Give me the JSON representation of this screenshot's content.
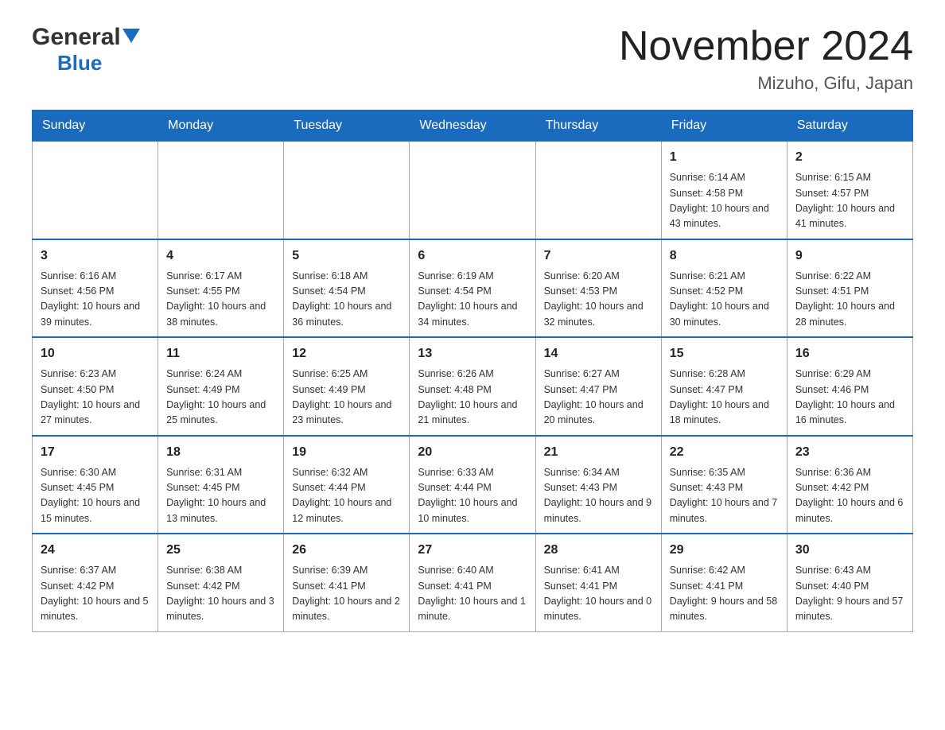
{
  "logo": {
    "general": "General",
    "blue": "Blue",
    "triangle_color": "#1a6bbd"
  },
  "header": {
    "month_year": "November 2024",
    "location": "Mizuho, Gifu, Japan"
  },
  "weekdays": [
    "Sunday",
    "Monday",
    "Tuesday",
    "Wednesday",
    "Thursday",
    "Friday",
    "Saturday"
  ],
  "weeks": [
    [
      {
        "day": "",
        "info": ""
      },
      {
        "day": "",
        "info": ""
      },
      {
        "day": "",
        "info": ""
      },
      {
        "day": "",
        "info": ""
      },
      {
        "day": "",
        "info": ""
      },
      {
        "day": "1",
        "info": "Sunrise: 6:14 AM\nSunset: 4:58 PM\nDaylight: 10 hours and 43 minutes."
      },
      {
        "day": "2",
        "info": "Sunrise: 6:15 AM\nSunset: 4:57 PM\nDaylight: 10 hours and 41 minutes."
      }
    ],
    [
      {
        "day": "3",
        "info": "Sunrise: 6:16 AM\nSunset: 4:56 PM\nDaylight: 10 hours and 39 minutes."
      },
      {
        "day": "4",
        "info": "Sunrise: 6:17 AM\nSunset: 4:55 PM\nDaylight: 10 hours and 38 minutes."
      },
      {
        "day": "5",
        "info": "Sunrise: 6:18 AM\nSunset: 4:54 PM\nDaylight: 10 hours and 36 minutes."
      },
      {
        "day": "6",
        "info": "Sunrise: 6:19 AM\nSunset: 4:54 PM\nDaylight: 10 hours and 34 minutes."
      },
      {
        "day": "7",
        "info": "Sunrise: 6:20 AM\nSunset: 4:53 PM\nDaylight: 10 hours and 32 minutes."
      },
      {
        "day": "8",
        "info": "Sunrise: 6:21 AM\nSunset: 4:52 PM\nDaylight: 10 hours and 30 minutes."
      },
      {
        "day": "9",
        "info": "Sunrise: 6:22 AM\nSunset: 4:51 PM\nDaylight: 10 hours and 28 minutes."
      }
    ],
    [
      {
        "day": "10",
        "info": "Sunrise: 6:23 AM\nSunset: 4:50 PM\nDaylight: 10 hours and 27 minutes."
      },
      {
        "day": "11",
        "info": "Sunrise: 6:24 AM\nSunset: 4:49 PM\nDaylight: 10 hours and 25 minutes."
      },
      {
        "day": "12",
        "info": "Sunrise: 6:25 AM\nSunset: 4:49 PM\nDaylight: 10 hours and 23 minutes."
      },
      {
        "day": "13",
        "info": "Sunrise: 6:26 AM\nSunset: 4:48 PM\nDaylight: 10 hours and 21 minutes."
      },
      {
        "day": "14",
        "info": "Sunrise: 6:27 AM\nSunset: 4:47 PM\nDaylight: 10 hours and 20 minutes."
      },
      {
        "day": "15",
        "info": "Sunrise: 6:28 AM\nSunset: 4:47 PM\nDaylight: 10 hours and 18 minutes."
      },
      {
        "day": "16",
        "info": "Sunrise: 6:29 AM\nSunset: 4:46 PM\nDaylight: 10 hours and 16 minutes."
      }
    ],
    [
      {
        "day": "17",
        "info": "Sunrise: 6:30 AM\nSunset: 4:45 PM\nDaylight: 10 hours and 15 minutes."
      },
      {
        "day": "18",
        "info": "Sunrise: 6:31 AM\nSunset: 4:45 PM\nDaylight: 10 hours and 13 minutes."
      },
      {
        "day": "19",
        "info": "Sunrise: 6:32 AM\nSunset: 4:44 PM\nDaylight: 10 hours and 12 minutes."
      },
      {
        "day": "20",
        "info": "Sunrise: 6:33 AM\nSunset: 4:44 PM\nDaylight: 10 hours and 10 minutes."
      },
      {
        "day": "21",
        "info": "Sunrise: 6:34 AM\nSunset: 4:43 PM\nDaylight: 10 hours and 9 minutes."
      },
      {
        "day": "22",
        "info": "Sunrise: 6:35 AM\nSunset: 4:43 PM\nDaylight: 10 hours and 7 minutes."
      },
      {
        "day": "23",
        "info": "Sunrise: 6:36 AM\nSunset: 4:42 PM\nDaylight: 10 hours and 6 minutes."
      }
    ],
    [
      {
        "day": "24",
        "info": "Sunrise: 6:37 AM\nSunset: 4:42 PM\nDaylight: 10 hours and 5 minutes."
      },
      {
        "day": "25",
        "info": "Sunrise: 6:38 AM\nSunset: 4:42 PM\nDaylight: 10 hours and 3 minutes."
      },
      {
        "day": "26",
        "info": "Sunrise: 6:39 AM\nSunset: 4:41 PM\nDaylight: 10 hours and 2 minutes."
      },
      {
        "day": "27",
        "info": "Sunrise: 6:40 AM\nSunset: 4:41 PM\nDaylight: 10 hours and 1 minute."
      },
      {
        "day": "28",
        "info": "Sunrise: 6:41 AM\nSunset: 4:41 PM\nDaylight: 10 hours and 0 minutes."
      },
      {
        "day": "29",
        "info": "Sunrise: 6:42 AM\nSunset: 4:41 PM\nDaylight: 9 hours and 58 minutes."
      },
      {
        "day": "30",
        "info": "Sunrise: 6:43 AM\nSunset: 4:40 PM\nDaylight: 9 hours and 57 minutes."
      }
    ]
  ]
}
